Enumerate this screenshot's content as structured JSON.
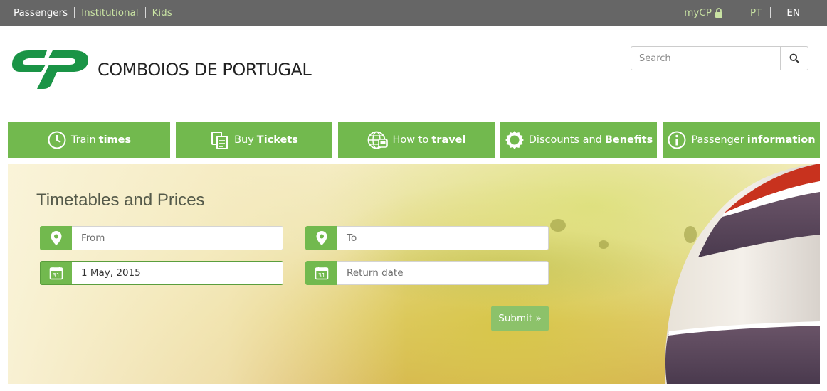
{
  "topbar": {
    "sections": [
      {
        "label": "Passengers",
        "active": true
      },
      {
        "label": "Institutional",
        "active": false
      },
      {
        "label": "Kids",
        "active": false
      }
    ],
    "mycp_label": "myCP",
    "mycp_icon": "lock-icon",
    "languages": [
      {
        "label": "PT",
        "selected": false
      },
      {
        "label": "EN",
        "selected": true
      }
    ]
  },
  "header": {
    "brand_name": "COMBOIOS DE PORTUGAL",
    "logo_icon": "cp-logo",
    "search": {
      "placeholder": "Search",
      "icon": "search-icon"
    }
  },
  "main_nav": [
    {
      "label_normal": "Train",
      "label_bold": "times",
      "icon": "clock-icon"
    },
    {
      "label_normal": "Buy",
      "label_bold": "Tickets",
      "icon": "tickets-icon"
    },
    {
      "label_normal": "How to",
      "label_bold": "travel",
      "icon": "globe-train-icon"
    },
    {
      "label_normal": "Discounts and",
      "label_bold": "Benefits",
      "icon": "gear-badge-icon"
    },
    {
      "label_normal": "Passenger",
      "label_bold": "information",
      "icon": "info-icon"
    }
  ],
  "search_form": {
    "title": "Timetables and Prices",
    "from": {
      "placeholder": "From",
      "value": "",
      "icon": "map-pin-icon"
    },
    "to": {
      "placeholder": "To",
      "value": "",
      "icon": "map-pin-icon"
    },
    "departure_date": {
      "value": "1 May, 2015",
      "icon": "calendar-icon",
      "icon_day": "31"
    },
    "return_date": {
      "placeholder": "Return date",
      "value": "",
      "icon": "calendar-icon",
      "icon_day": "31"
    },
    "submit_label": "Submit »"
  },
  "colors": {
    "brand_green": "#72b94e",
    "topbar_bg": "#666666",
    "topbar_link": "#c9e3a3",
    "submit_bg": "#8cc26a",
    "train_red": "#c8321e",
    "train_purple": "#5a4a5e"
  }
}
